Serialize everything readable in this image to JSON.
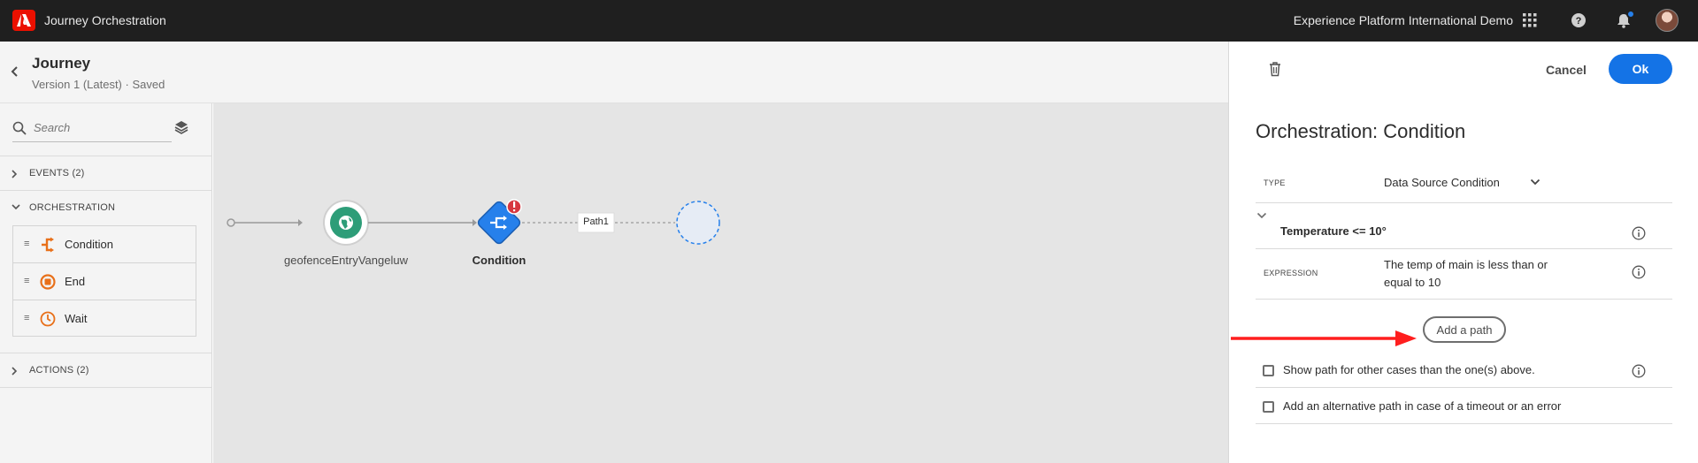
{
  "topbar": {
    "app_title": "Journey Orchestration",
    "org_name": "Experience Platform International Demo",
    "icons": [
      "adobe-logo",
      "app-switcher-icon",
      "help-icon",
      "bell-icon",
      "avatar"
    ]
  },
  "journey": {
    "title": "Journey",
    "version": "Version 1 (Latest) · Saved"
  },
  "palette": {
    "search_placeholder": "Search",
    "sections": {
      "events": "EVENTS (2)",
      "orchestration": "ORCHESTRATION",
      "actions": "ACTIONS (2)"
    },
    "orchestration_items": [
      {
        "label": "Condition",
        "icon": "condition-icon"
      },
      {
        "label": "End",
        "icon": "end-icon"
      },
      {
        "label": "Wait",
        "icon": "wait-icon"
      }
    ]
  },
  "canvas": {
    "nodes": {
      "event_label": "geofenceEntryVangeluw",
      "condition_label": "Condition",
      "path_label": "Path1"
    }
  },
  "panel": {
    "cancel_label": "Cancel",
    "ok_label": "Ok",
    "title": "Orchestration: Condition",
    "type_label": "TYPE",
    "type_value": "Data Source Condition",
    "condition_name": "Temperature <= 10°",
    "expression_label": "EXPRESSION",
    "expression_value": "The temp of main is less than or equal to 10",
    "add_path_label": "Add a path",
    "show_other_cases_label": "Show path for other cases than the one(s) above.",
    "alt_path_label": "Add an alternative path in case of a timeout or an error"
  },
  "colors": {
    "accent_blue": "#1473e6",
    "orchestration_orange": "#e8701a",
    "event_green": "#2d9d78",
    "error_red": "#d7373f",
    "annotation_red": "#ff1e1e"
  }
}
